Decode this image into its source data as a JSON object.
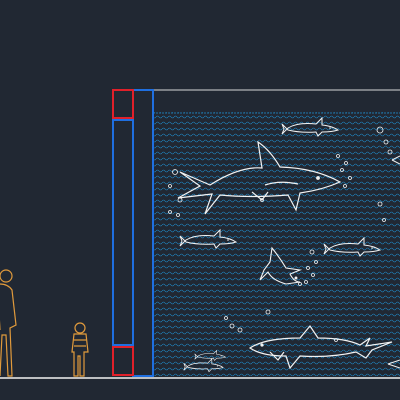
{
  "drawing": {
    "background_color": "#212833",
    "wall_color": "#1f6fe0",
    "detail_color": "#e0202a",
    "line_color": "#f2f2f2",
    "water_pattern_color": "#1e8fd0",
    "figure_color": "#e09a3c"
  },
  "sharks": [
    {
      "name": "large-shark",
      "kind": "large"
    },
    {
      "name": "small-shark-top",
      "kind": "small"
    },
    {
      "name": "small-shark-mid-left",
      "kind": "small"
    },
    {
      "name": "small-shark-mid-right",
      "kind": "small"
    },
    {
      "name": "diving-shark",
      "kind": "diving"
    },
    {
      "name": "bottom-shark",
      "kind": "large"
    },
    {
      "name": "tiny-shark-bottom",
      "kind": "small"
    }
  ],
  "people": [
    {
      "name": "adult-figure"
    },
    {
      "name": "child-figure"
    }
  ]
}
